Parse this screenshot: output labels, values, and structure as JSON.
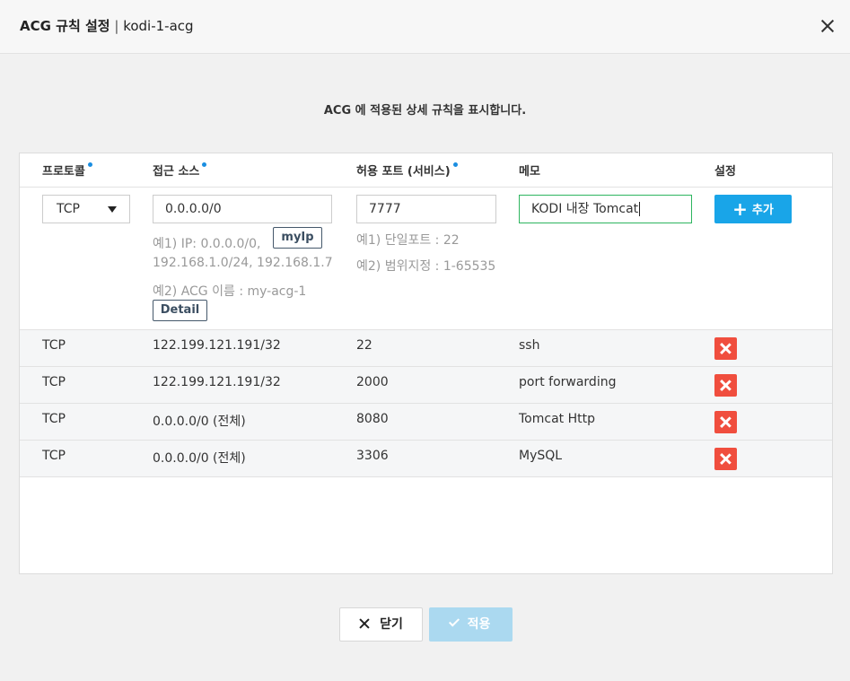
{
  "header": {
    "title": "ACG 규칙 설정",
    "separator": "|",
    "acg_name": "kodi-1-acg"
  },
  "description": "ACG 에 적용된 상세 규칙을 표시합니다.",
  "table": {
    "columns": [
      "프로토콜",
      "접근 소스",
      "허용 포트 (서비스)",
      "메모",
      "설정"
    ],
    "required_columns": [
      0,
      1,
      2
    ],
    "new_rule": {
      "protocol": "TCP",
      "source": "0.0.0.0/0",
      "port": "7777",
      "memo": "KODI 내장 Tomcat",
      "source_hint_1": "예1) IP: 0.0.0.0/0,",
      "source_hint_2": "192.168.1.0/24, 192.168.1.7",
      "source_hint_3": "예2) ACG 이름 : my-acg-1",
      "myip_label": "myIp",
      "detail_label": "Detail",
      "port_hint_1": "예1) 단일포트 : 22",
      "port_hint_2": "예2) 범위지정 : 1-65535",
      "add_label": "추가"
    },
    "rows": [
      {
        "protocol": "TCP",
        "source": "122.199.121.191/32",
        "port": "22",
        "memo": "ssh"
      },
      {
        "protocol": "TCP",
        "source": "122.199.121.191/32",
        "port": "2000",
        "memo": "port forwarding"
      },
      {
        "protocol": "TCP",
        "source": "0.0.0.0/0 (전체)",
        "port": "8080",
        "memo": "Tomcat Http"
      },
      {
        "protocol": "TCP",
        "source": "0.0.0.0/0 (전체)",
        "port": "3306",
        "memo": "MySQL"
      }
    ]
  },
  "footer": {
    "close_label": "닫기",
    "apply_label": "적용"
  },
  "colors": {
    "accent": "#19a5e8",
    "delete": "#f04e3e",
    "apply_disabled": "#abd9f0",
    "focus_border": "#2eb55f",
    "required_dot": "#1a8ee1"
  }
}
